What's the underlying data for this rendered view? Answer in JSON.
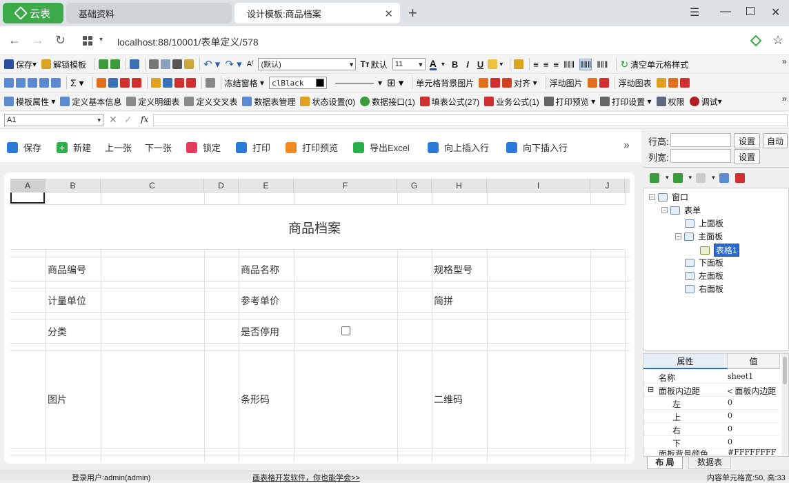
{
  "browser": {
    "brand": "云表",
    "tabs": [
      {
        "label": "基础资料"
      },
      {
        "label": "设计模板:商品档案"
      }
    ],
    "url": "localhost:88/10001/表单定义/578"
  },
  "toolbar1": {
    "save": "保存",
    "unlock": "解锁模板",
    "font_name": "(默认)",
    "default": "默认",
    "font_size": "11",
    "b": "B",
    "i": "I",
    "u": "U",
    "clear_fmt": "清空单元格样式"
  },
  "toolbar2": {
    "sigma": "Σ",
    "freeze": "冻结窗格",
    "color": "clBlack",
    "cell_bg_img": "单元格背景图片",
    "align": "对齐",
    "float_img": "浮动图片",
    "float_chart": "浮动图表"
  },
  "toolbar3": {
    "template_props": "模板属性",
    "basic_info": "定义基本信息",
    "detail_table": "定义明细表",
    "cross_table": "定义交叉表",
    "data_mgmt": "数据表管理",
    "status_set": "状态设置(0)",
    "data_api": "数据接口(1)",
    "fill_formula": "填表公式(27)",
    "biz_formula": "业务公式(1)",
    "print_preview": "打印预览",
    "print_set": "打印设置",
    "perm": "权限",
    "debug": "调试"
  },
  "formula_bar": {
    "cell_ref": "A1",
    "fx": "fx"
  },
  "actions": {
    "save": "保存",
    "new": "新建",
    "prev": "上一张",
    "next": "下一张",
    "lock": "锁定",
    "print": "打印",
    "preview": "打印预览",
    "export": "导出Excel",
    "insert_up": "向上插入行",
    "insert_down": "向下插入行"
  },
  "sheet": {
    "columns": [
      "A",
      "B",
      "C",
      "D",
      "E",
      "F",
      "G",
      "H",
      "I",
      "J"
    ],
    "title": "商品档案",
    "labels": {
      "code": "商品编号",
      "name": "商品名称",
      "spec": "规格型号",
      "unit": "计量单位",
      "price": "参考单价",
      "pinyin": "简拼",
      "category": "分类",
      "disabled": "是否停用",
      "image": "图片",
      "barcode": "条形码",
      "qrcode": "二维码"
    },
    "disabled_checked": false
  },
  "right_panel": {
    "row_height": "行高:",
    "col_width": "列宽:",
    "set": "设置",
    "auto": "自动",
    "tree": {
      "window": "窗口",
      "form": "表单",
      "top_panel": "上面板",
      "main_panel": "主面板",
      "table1": "表格1",
      "bottom_panel": "下面板",
      "left_panel": "左面板",
      "right_panel": "右面板"
    },
    "props": {
      "h_attr": "属性",
      "h_val": "值",
      "rows": [
        {
          "k": "名称",
          "v": "sheet1"
        },
        {
          "k": "面板内边距",
          "v": "< 面板内边距"
        },
        {
          "k": "左",
          "v": "0"
        },
        {
          "k": "上",
          "v": "0"
        },
        {
          "k": "右",
          "v": "0"
        },
        {
          "k": "下",
          "v": "0"
        },
        {
          "k": "面板背景颜色",
          "v": "#FFFFFFFF"
        }
      ]
    },
    "tabs": {
      "layout": "布 局",
      "datatable": "数据表"
    }
  },
  "status": {
    "user": "登录用户:admin(admin)",
    "slogan": "画表格开发软件，你也能学会>>",
    "cell_size": "内容单元格宽:50, 高:33"
  }
}
